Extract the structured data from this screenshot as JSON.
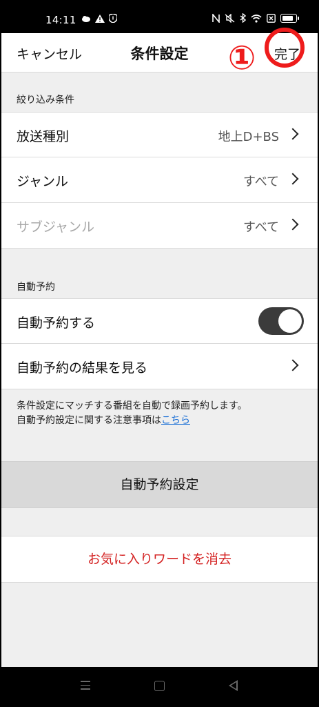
{
  "status": {
    "time": "14:11"
  },
  "nav": {
    "cancel": "キャンセル",
    "title": "条件設定",
    "done": "完了",
    "annotation": "①"
  },
  "filter": {
    "header": "絞り込み条件",
    "rows": [
      {
        "label": "放送種別",
        "value": "地上D+BS"
      },
      {
        "label": "ジャンル",
        "value": "すべて"
      },
      {
        "label": "サブジャンル",
        "value": "すべて"
      }
    ]
  },
  "auto": {
    "header": "自動予約",
    "toggle_label": "自動予約する",
    "toggle_on": true,
    "results_label": "自動予約の結果を見る",
    "note_line1": "条件設定にマッチする番組を自動で録画予約します。",
    "note_line2": "自動予約設定に関する注意事項は",
    "note_link": "こちら"
  },
  "buttons": {
    "auto_setting": "自動予約設定",
    "clear_words": "お気に入りワードを消去"
  },
  "colors": {
    "accent_red": "#d42323",
    "annotation_red": "#ee1c1c",
    "link_blue": "#1a6fd6",
    "toggle_on": "#3b3b3b"
  }
}
